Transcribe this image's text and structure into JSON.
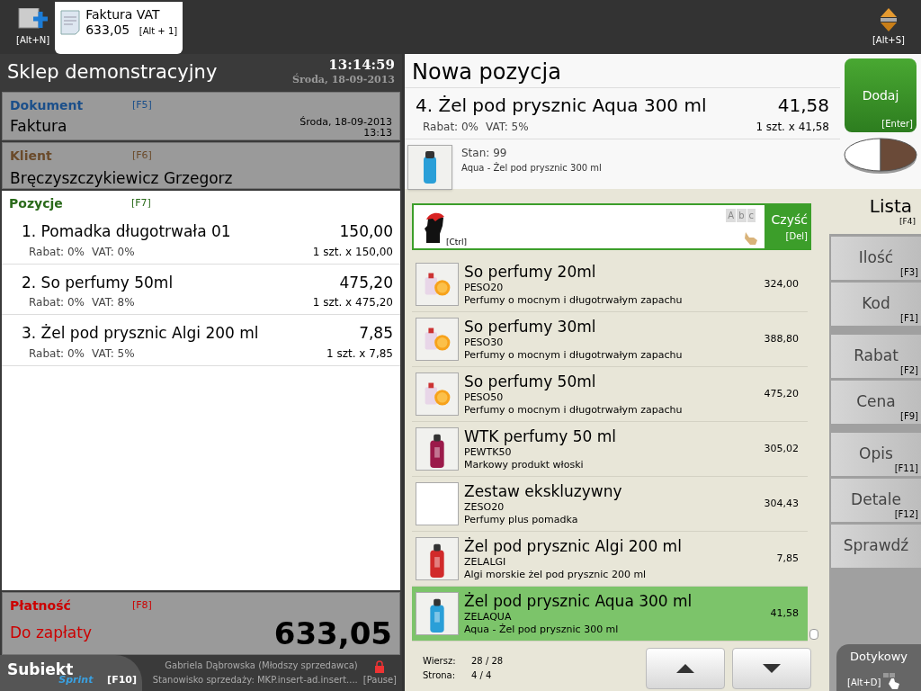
{
  "top_bar": {
    "new_hint": "[Alt+N]",
    "tabs": [
      {
        "title": "Faktura VAT",
        "amount": "633,05",
        "hint": "[Alt + 1]",
        "selected": true
      }
    ],
    "switch_hint": "[Alt+S]"
  },
  "store": {
    "name": "Sklep demonstracyjny",
    "time": "13:14:59",
    "date": "Środa, 18-09-2013"
  },
  "document": {
    "label": "Dokument",
    "key": "[F5]",
    "value": "Faktura",
    "date": "Środa, 18-09-2013",
    "time": "13:13"
  },
  "client": {
    "label": "Klient",
    "key": "[F6]",
    "value": "Bręczyszczykiewicz Grzegorz"
  },
  "positions": {
    "label": "Pozycje",
    "key": "[F7]",
    "items": [
      {
        "name": "1. Pomadka długotrwała 01",
        "price": "150,00",
        "discount": "Rabat: 0%",
        "vat": "VAT: 0%",
        "qty": "1 szt. x 150,00"
      },
      {
        "name": "2. So perfumy 50ml",
        "price": "475,20",
        "discount": "Rabat: 0%",
        "vat": "VAT: 8%",
        "qty": "1 szt. x 475,20"
      },
      {
        "name": "3. Żel pod prysznic Algi 200 ml",
        "price": "7,85",
        "discount": "Rabat: 0%",
        "vat": "VAT: 5%",
        "qty": "1 szt. x 7,85"
      }
    ]
  },
  "payment": {
    "label": "Płatność",
    "key": "[F8]",
    "due_label": "Do zapłaty",
    "due": "633,05"
  },
  "footer": {
    "logo_main": "Subiekt",
    "logo_sub": "Sprint",
    "logo_key": "[F10]",
    "user": "Gabriela Dąbrowska (Młodszy sprzedawca)",
    "station": "Stanowisko sprzedaży: MKP.insert-ad.insert....",
    "pause": "[Pause]"
  },
  "new_position": {
    "title": "Nowa pozycja",
    "name": "4. Żel pod prysznic Aqua 300 ml",
    "price": "41,58",
    "discount": "Rabat: 0%",
    "vat": "VAT: 5%",
    "qty": "1 szt. x 41,58",
    "stock": "Stan: 99",
    "description": "Aqua - Żel pod prysznic 300 ml",
    "add_button": "Dodaj",
    "add_key": "[Enter]"
  },
  "search": {
    "ctrl": "[Ctrl]",
    "keys": [
      "A",
      "b",
      "c"
    ],
    "clear": "Czyść",
    "clear_key": "[Del]"
  },
  "products": [
    {
      "name": "So perfumy 20ml",
      "code": "PESO20",
      "description": "Perfumy o mocnym i długotrwałym zapachu",
      "price": "324,00",
      "kind": "picture",
      "selected": false
    },
    {
      "name": "So perfumy 30ml",
      "code": "PESO30",
      "description": "Perfumy o mocnym i długotrwałym zapachu",
      "price": "388,80",
      "kind": "picture",
      "selected": false
    },
    {
      "name": "So perfumy 50ml",
      "code": "PESO50",
      "description": "Perfumy o mocnym i długotrwałym zapachu",
      "price": "475,20",
      "kind": "picture",
      "selected": false
    },
    {
      "name": "WTK perfumy 50 ml",
      "code": "PEWTK50",
      "description": "Markowy produkt włoski",
      "price": "305,02",
      "kind": "picture",
      "selected": false
    },
    {
      "name": "Zestaw ekskluzywny",
      "code": "ZESO20",
      "description": "Perfumy plus pomadka",
      "price": "304,43",
      "kind": "empty",
      "selected": false
    },
    {
      "name": "Żel pod prysznic Algi 200 ml",
      "code": "ZELALGI",
      "description": "Algi morskie żel pod prysznic 200 ml",
      "price": "7,85",
      "kind": "picture",
      "selected": false
    },
    {
      "name": "Żel pod prysznic Aqua 300 ml",
      "code": "ZELAQUA",
      "description": "Aqua - Żel pod prysznic 300 ml",
      "price": "41,58",
      "kind": "picture",
      "selected": true
    }
  ],
  "pager": {
    "row_label": "Wiersz:",
    "row": "28 / 28",
    "page_label": "Strona:",
    "page": "4 / 4"
  },
  "side": {
    "title": "Lista",
    "title_key": "[F4]",
    "buttons": [
      {
        "label": "Ilość",
        "key": "[F3]"
      },
      {
        "label": "Kod",
        "key": "[F1]"
      },
      {
        "label": "Rabat",
        "key": "[F2]"
      },
      {
        "label": "Cena",
        "key": "[F9]"
      },
      {
        "label": "Opis",
        "key": "[F11]"
      },
      {
        "label": "Detale",
        "key": "[F12]"
      },
      {
        "label": "Sprawdź"
      }
    ],
    "touch": "Dotykowy",
    "touch_key": "[Alt+D]"
  }
}
